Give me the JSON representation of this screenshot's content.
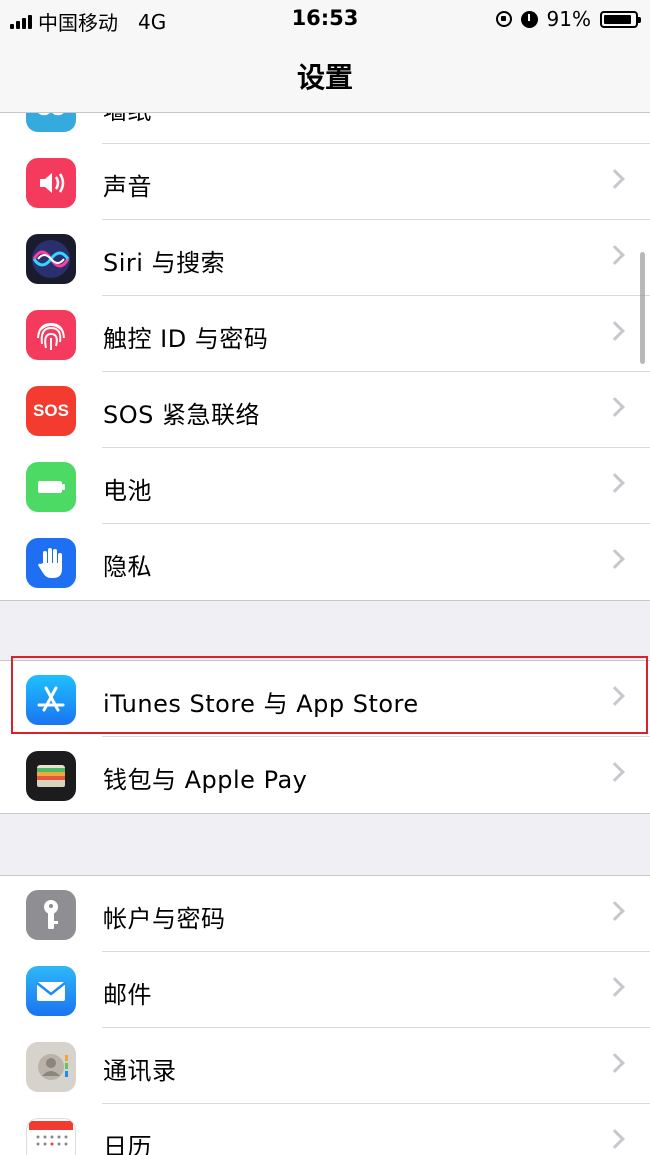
{
  "status": {
    "carrier": "中国移动",
    "network": "4G",
    "time": "16:53",
    "battery": "91%",
    "battery_level": 0.91
  },
  "nav": {
    "title": "设置"
  },
  "groups": [
    {
      "items": [
        {
          "label": "墙纸",
          "icon": "wallpaper-icon",
          "color": "#35aadc"
        },
        {
          "label": "声音",
          "icon": "sound-icon",
          "color": "#f43b5e"
        },
        {
          "label": "Siri 与搜索",
          "icon": "siri-icon",
          "color": "#1b1b2e"
        },
        {
          "label": "触控 ID 与密码",
          "icon": "fingerprint-icon",
          "color": "#f43b5e"
        },
        {
          "label": "SOS 紧急联络",
          "icon": "sos-icon",
          "color": "#f33b30",
          "icon_text": "SOS"
        },
        {
          "label": "电池",
          "icon": "battery-icon",
          "color": "#4cd964"
        },
        {
          "label": "隐私",
          "icon": "hand-icon",
          "color": "#1f6ff2"
        }
      ]
    },
    {
      "items": [
        {
          "label": "iTunes Store 与 App Store",
          "icon": "app-store-icon",
          "color": "#1a8cf5"
        },
        {
          "label": "钱包与 Apple Pay",
          "icon": "wallet-icon",
          "color": "#1c1c1e"
        }
      ]
    },
    {
      "items": [
        {
          "label": "帐户与密码",
          "icon": "key-icon",
          "color": "#8e8e93"
        },
        {
          "label": "邮件",
          "icon": "mail-icon",
          "color": "#1e8cf5"
        },
        {
          "label": "通讯录",
          "icon": "contacts-icon",
          "color": "#c9c5c0"
        },
        {
          "label": "日历",
          "icon": "calendar-icon",
          "color": "#ffffff"
        }
      ]
    }
  ]
}
